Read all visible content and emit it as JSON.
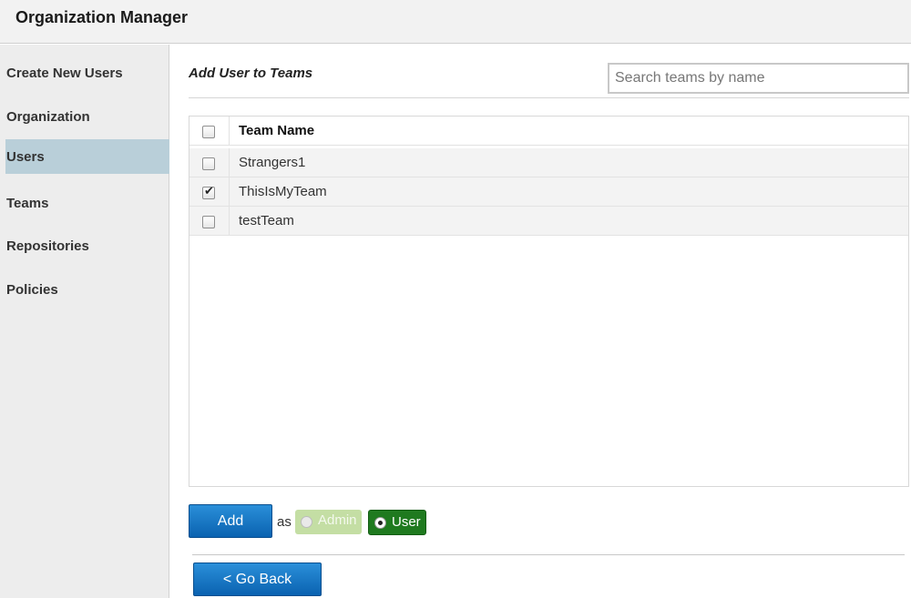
{
  "header": {
    "title": "Organization Manager"
  },
  "sidebar": {
    "items": [
      {
        "label": "Create New Users"
      },
      {
        "label": "Organization"
      },
      {
        "label": "Users",
        "active": true
      },
      {
        "label": "Teams"
      },
      {
        "label": "Repositories"
      },
      {
        "label": "Policies"
      }
    ]
  },
  "panel": {
    "title": "Add User to Teams",
    "search_placeholder": "Search teams by name"
  },
  "table": {
    "header": "Team Name",
    "rows": [
      {
        "name": "Strangers1",
        "checked": false
      },
      {
        "name": "ThisIsMyTeam",
        "checked": true
      },
      {
        "name": "testTeam",
        "checked": false
      }
    ]
  },
  "actions": {
    "add_label": "Add",
    "as_label": "as",
    "roles": [
      {
        "label": "Admin",
        "selected": false
      },
      {
        "label": "User",
        "selected": true
      }
    ],
    "back_label": "< Go Back"
  },
  "colors": {
    "sidebar_active": "#b9cfd9",
    "primary_button": "#0a62b0",
    "user_role": "#1f7a1f",
    "admin_role": "#c4dea4"
  }
}
